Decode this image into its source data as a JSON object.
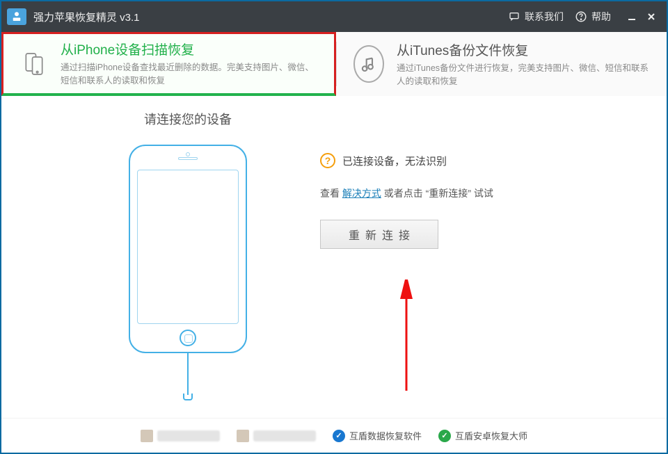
{
  "titlebar": {
    "app_title": "强力苹果恢复精灵 v3.1",
    "contact_label": "联系我们",
    "help_label": "帮助"
  },
  "tabs": {
    "iphone": {
      "title": "从iPhone设备扫描恢复",
      "sub": "通过扫描iPhone设备查找最近删除的数据。完美支持图片、微信、短信和联系人的读取和恢复"
    },
    "itunes": {
      "title": "从iTunes备份文件恢复",
      "sub": "通过iTunes备份文件进行恢复，完美支持图片、微信、短信和联系人的读取和恢复"
    }
  },
  "main": {
    "connect_heading": "请连接您的设备",
    "status_text": "已连接设备，无法识别",
    "hint_prefix": "查看 ",
    "hint_link": "解决方式",
    "hint_suffix": " 或者点击 “重新连接” 试试",
    "reconnect_label": "重新连接"
  },
  "footer": {
    "link1": "互盾数据恢复软件",
    "link2": "互盾安卓恢复大师"
  }
}
